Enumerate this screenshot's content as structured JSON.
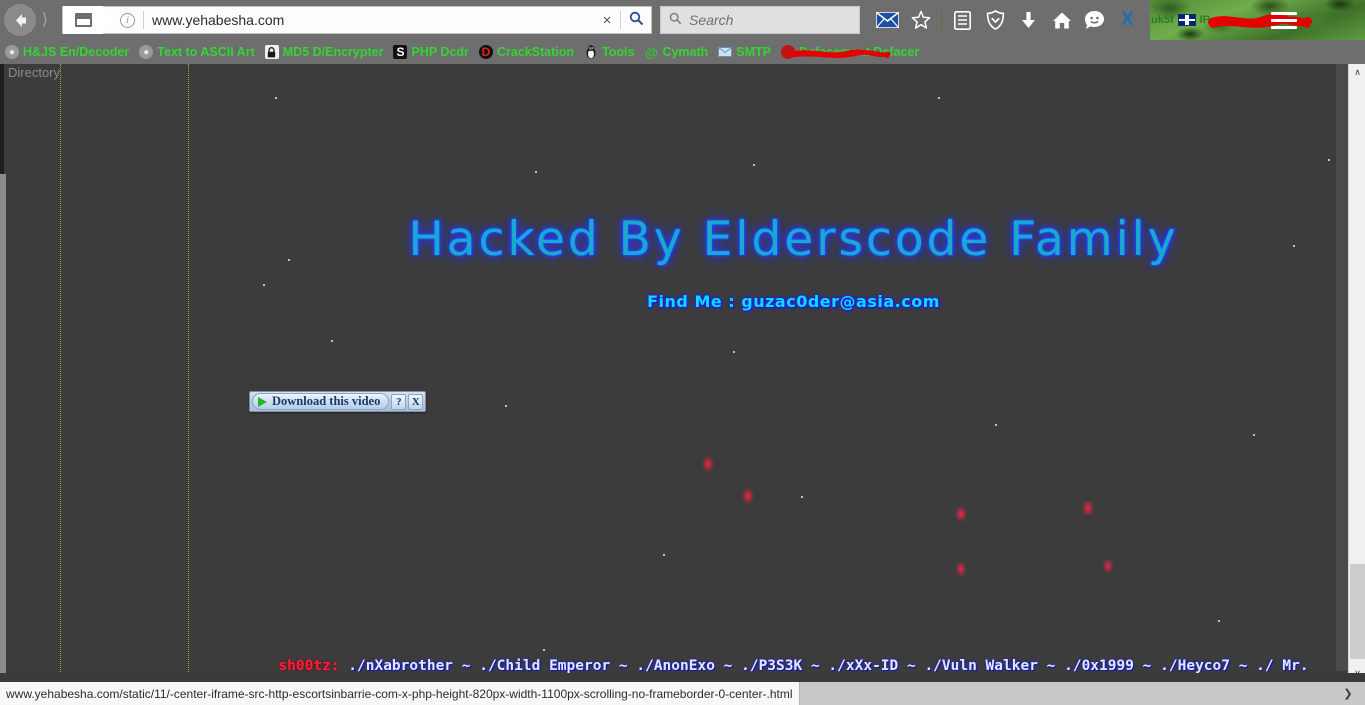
{
  "browser": {
    "nav": {
      "back_icon": "back-arrow-icon",
      "forward_icon": "forward-arrow-icon",
      "site_icon": "page-icon",
      "info_icon": "info-icon",
      "url_value": "www.yehabesha.com",
      "url_clear_label": "×",
      "url_go_label": "⌕"
    },
    "search": {
      "placeholder": "Search",
      "icon": "search-icon"
    },
    "toolbar_icons": [
      {
        "name": "mail-icon",
        "glyph": "✉"
      },
      {
        "name": "star-bookmark-icon",
        "glyph": "☆"
      },
      {
        "name": "library-icon",
        "glyph": "☰"
      },
      {
        "name": "shield-icon",
        "glyph": "⬡"
      },
      {
        "name": "chevron-down-circle-icon",
        "glyph": "˅"
      },
      {
        "name": "download-icon",
        "glyph": "↓"
      },
      {
        "name": "home-icon",
        "glyph": "⌂"
      },
      {
        "name": "chat-smiley-icon",
        "glyph": "☺"
      },
      {
        "name": "close-x-icon",
        "glyph": "X"
      }
    ],
    "ipinfo": {
      "prefix": "uk5f",
      "flag_icon": "uk-flag-icon",
      "ip_label": "IP :",
      "ip_value_redacted": "████████"
    },
    "menu_icon": "hamburger-menu-icon"
  },
  "bookmarks": [
    {
      "icon": "globe-icon",
      "icon_class": "ico-globe",
      "glyph": "●",
      "label": "H&JS En/Decoder",
      "redacted": false
    },
    {
      "icon": "globe-icon",
      "icon_class": "ico-globe",
      "glyph": "●",
      "label": "Text to ASCII Art",
      "redacted": false
    },
    {
      "icon": "lock-icon",
      "icon_class": "ico-lock",
      "glyph": "🔒",
      "label": "MD5 D/Encrypter",
      "redacted": false
    },
    {
      "icon": "letter-s-icon",
      "icon_class": "ico-s",
      "glyph": "S",
      "label": "PHP Dcdr",
      "redacted": false
    },
    {
      "icon": "letter-d-icon",
      "icon_class": "ico-d",
      "glyph": "D",
      "label": "CrackStation",
      "redacted": false
    },
    {
      "icon": "penguin-icon",
      "icon_class": "ico-peng",
      "glyph": "🐧",
      "label": "Tools",
      "redacted": false
    },
    {
      "icon": "at-sign-icon",
      "icon_class": "ico-at",
      "glyph": "@",
      "label": "Cymath",
      "redacted": false
    },
    {
      "icon": "mail-icon",
      "icon_class": "ico-mail",
      "glyph": "✉",
      "label": "SMTP",
      "redacted": false
    },
    {
      "icon": "dot-icon",
      "icon_class": "ico-dot",
      "glyph": "",
      "label": "Defacement Defacer",
      "redacted": true
    }
  ],
  "page": {
    "directory_label": "Directory",
    "title": "Hacked By Elderscode Family",
    "contact": "Find Me : guzac0der@asia.com",
    "marquee_nick": "sh00tz:",
    "marquee_crew": "./nXabrother ~ ./Child Emperor ~ ./AnonExo ~ ./P3S3K ~ ./xXx-ID ~ ./Vuln Walker ~ ./0x1999 ~ ./Heyco7 ~ ./ Mr.",
    "download_helper": {
      "label": "Download this video",
      "help_label": "?",
      "close_label": "X",
      "play_icon": "play-triangle-icon"
    }
  },
  "scrollbars": {
    "up_arrow": "∧",
    "down_arrow": "∨",
    "right_arrow": "❯"
  },
  "statusbar": {
    "url": "www.yehabesha.com/static/11/-center-iframe-src-http-escortsinbarrie-com-x-php-height-820px-width-1100px-scrolling-no-frameborder-0-center-.html"
  },
  "colors": {
    "chrome_grey": "#6e6e6e",
    "bookmark_green": "#35d435",
    "title_cyan": "#1fa8c9",
    "title_glow_blue": "#2030ff",
    "contact_cyan": "#12d9ff",
    "marquee_red": "#ff1f3a",
    "redaction_red": "#e40000",
    "camo_green": "#5f9b40"
  }
}
